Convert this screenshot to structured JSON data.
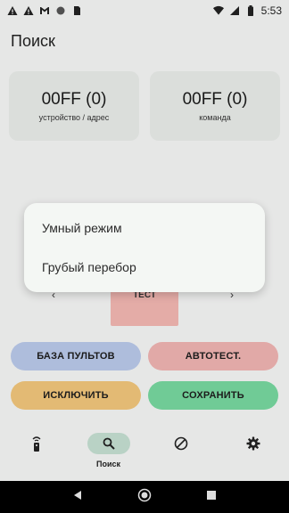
{
  "status_bar": {
    "time": "5:53"
  },
  "header": {
    "title": "Поиск"
  },
  "cards": [
    {
      "value": "00FF (0)",
      "label": "устройство / адрес"
    },
    {
      "value": "00FF (0)",
      "label": "команда"
    }
  ],
  "controls": {
    "test_label": "ТЕСТ",
    "prev": "‹",
    "next": "›"
  },
  "buttons": {
    "db": "БАЗА ПУЛЬТОВ",
    "autotest": "АВТОТЕСТ.",
    "exclude": "ИСКЛЮЧИТЬ",
    "save": "СОХРАНИТЬ"
  },
  "nav": {
    "items": [
      {
        "icon": "remote-icon",
        "label": ""
      },
      {
        "icon": "search-icon",
        "label": "Поиск"
      },
      {
        "icon": "block-icon",
        "label": ""
      },
      {
        "icon": "gear-icon",
        "label": ""
      }
    ]
  },
  "popup": {
    "items": [
      {
        "label": "Умный режим"
      },
      {
        "label": "Грубый перебор"
      }
    ]
  },
  "colors": {
    "accent_nav": "#c5e0d2",
    "db_button": "#b9c9ea",
    "autotest_button": "#f0b4b2",
    "exclude_button": "#f2c67c",
    "save_button": "#78d8a0"
  }
}
